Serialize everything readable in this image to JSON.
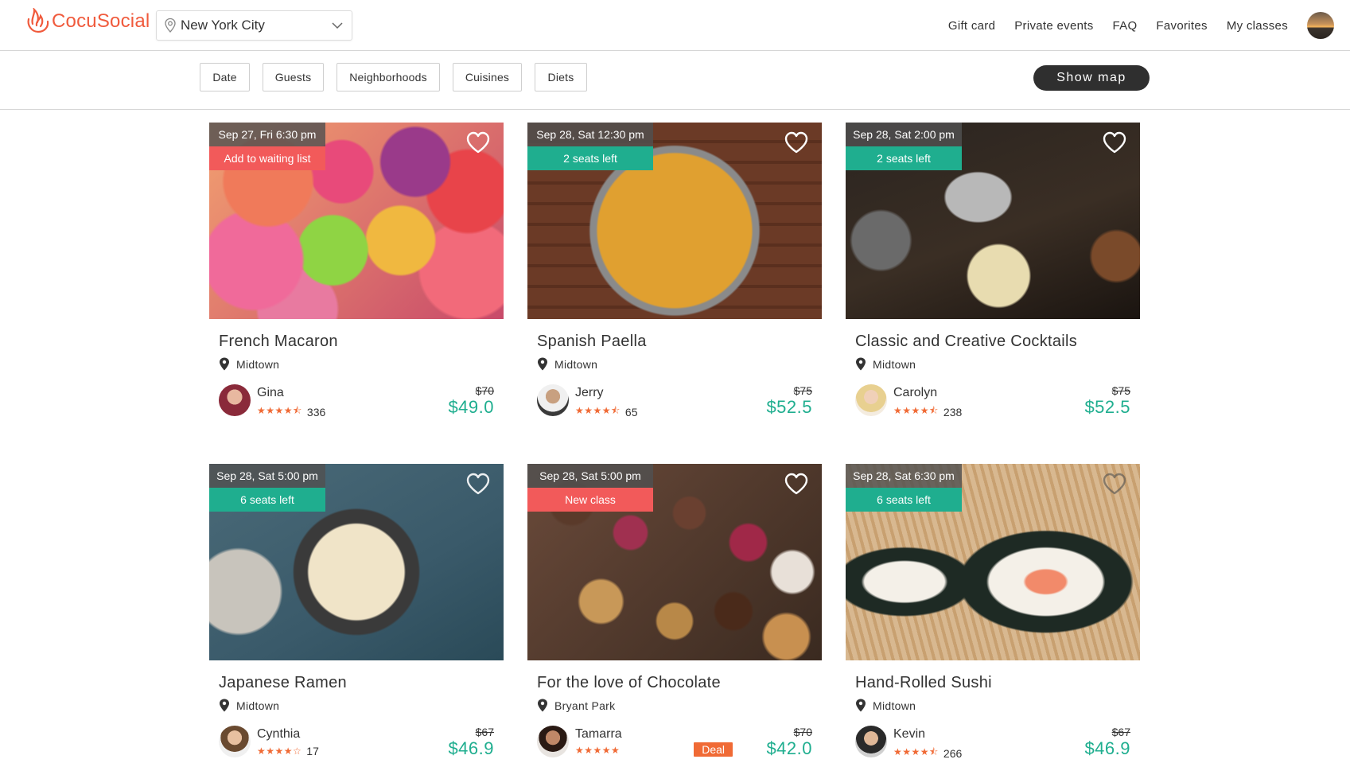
{
  "header": {
    "logo_text": "CocuSocial",
    "city": "New York City",
    "nav": [
      "Gift card",
      "Private events",
      "FAQ",
      "Favorites",
      "My classes"
    ]
  },
  "filters": {
    "buttons": [
      "Date",
      "Guests",
      "Neighborhoods",
      "Cuisines",
      "Diets"
    ],
    "show_map": "Show map"
  },
  "colors": {
    "brand": "#f05a3c",
    "green": "#1fae8f",
    "red": "#f25a5a",
    "star": "#f06a35"
  },
  "cards": [
    {
      "date": "Sep 27, Fri 6:30 pm",
      "status": "Add to waiting list",
      "status_color": "red",
      "title": "French Macaron",
      "location": "Midtown",
      "host": "Gina",
      "stars": "★★★★⯪",
      "reviews": "336",
      "old_price": "$70",
      "price": "$49.0",
      "deal": ""
    },
    {
      "date": "Sep 28, Sat 12:30 pm",
      "status": "2 seats left",
      "status_color": "green",
      "title": "Spanish Paella",
      "location": "Midtown",
      "host": "Jerry",
      "stars": "★★★★⯪",
      "reviews": "65",
      "old_price": "$75",
      "price": "$52.5",
      "deal": ""
    },
    {
      "date": "Sep 28, Sat 2:00 pm",
      "status": "2 seats left",
      "status_color": "green",
      "title": "Classic and Creative Cocktails",
      "location": "Midtown",
      "host": "Carolyn",
      "stars": "★★★★⯪",
      "reviews": "238",
      "old_price": "$75",
      "price": "$52.5",
      "deal": ""
    },
    {
      "date": "Sep 28, Sat 5:00 pm",
      "status": "6 seats left",
      "status_color": "green",
      "title": "Japanese Ramen",
      "location": "Midtown",
      "host": "Cynthia",
      "stars": "★★★★☆",
      "reviews": "17",
      "old_price": "$67",
      "price": "$46.9",
      "deal": ""
    },
    {
      "date": "Sep 28, Sat 5:00 pm",
      "status": "New class",
      "status_color": "red",
      "title": "For the love of Chocolate",
      "location": "Bryant Park",
      "host": "Tamarra",
      "stars": "★★★★★",
      "reviews": "",
      "old_price": "$70",
      "price": "$42.0",
      "deal": "Deal"
    },
    {
      "date": "Sep 28, Sat 6:30 pm",
      "status": "6 seats left",
      "status_color": "green",
      "title": "Hand-Rolled Sushi",
      "location": "Midtown",
      "host": "Kevin",
      "stars": "★★★★⯪",
      "reviews": "266",
      "old_price": "$67",
      "price": "$46.9",
      "deal": ""
    }
  ]
}
